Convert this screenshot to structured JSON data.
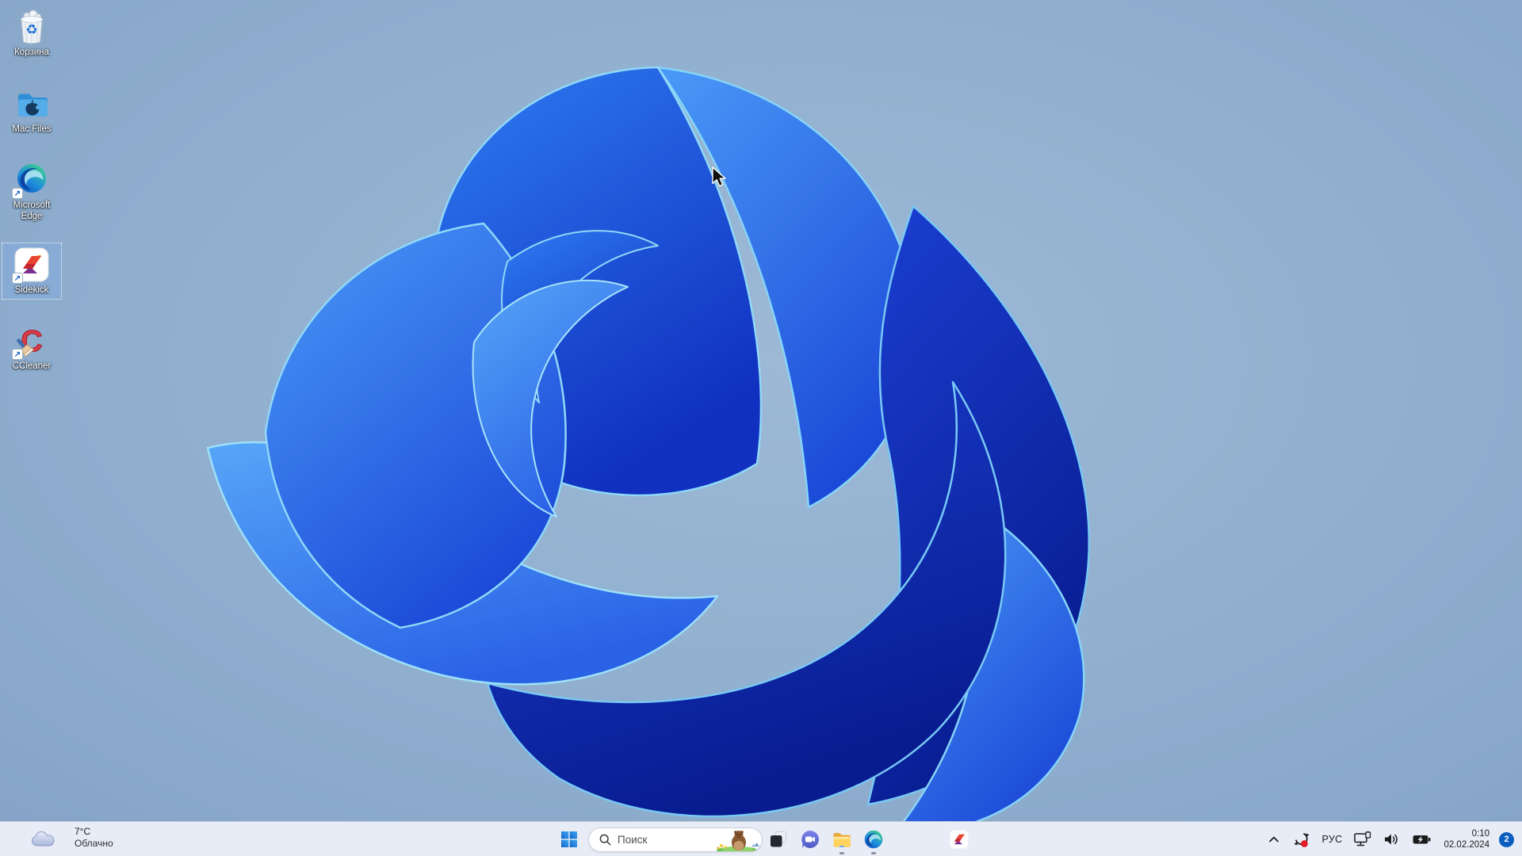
{
  "desktop": {
    "icons": [
      {
        "label": "Корзина"
      },
      {
        "label": "Mac Files"
      },
      {
        "label": "Microsoft Edge"
      },
      {
        "label": "Sidekick",
        "selected": true
      },
      {
        "label": "CCleaner"
      }
    ]
  },
  "glyphs": {
    "recycle": "♻",
    "shortcut_arrow": "↗",
    "ccleaner_letter": "C"
  },
  "taskbar": {
    "weather": {
      "temperature": "7°C",
      "condition": "Облачно"
    },
    "search": {
      "placeholder": "Поиск"
    },
    "apps": [
      {
        "name": "task-view"
      },
      {
        "name": "chat"
      },
      {
        "name": "file-explorer",
        "running": true
      },
      {
        "name": "microsoft-edge",
        "running": true
      },
      {
        "name": "sidekick",
        "running": false
      }
    ],
    "tray": {
      "language": "РУС",
      "time": "0:10",
      "date": "02.02.2024",
      "notification_count": "2"
    }
  },
  "colors": {
    "accent": "#0a5dbe",
    "taskbar_bg": "#e7ecf6",
    "selection": "rgba(125,170,225,0.38)",
    "bloom_deep": "#081c90",
    "bloom_bright": "#57a6f8",
    "bloom_rim": "#8fd8f8"
  }
}
